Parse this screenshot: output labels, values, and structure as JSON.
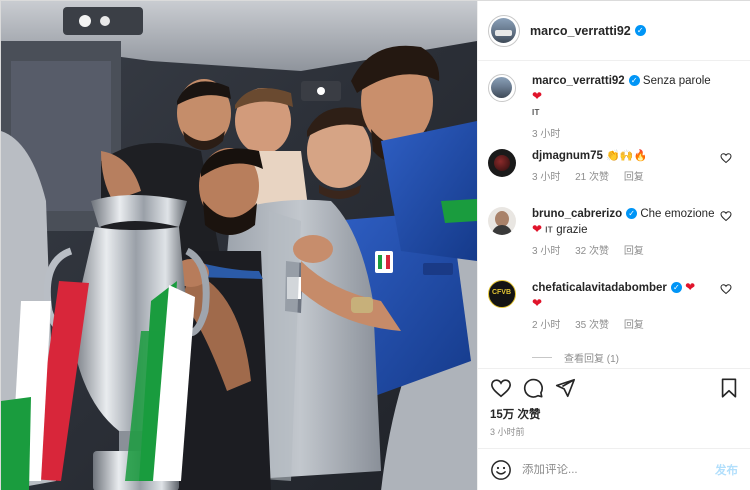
{
  "post": {
    "author": "marco_verratti92",
    "author_verified": true,
    "caption": {
      "text": "Senza parole",
      "heart": "❤",
      "flag": "IT",
      "time": "3 小时"
    },
    "photo_description_icon": "team-photo-with-trophy"
  },
  "comments": [
    {
      "user": "djmagnum75",
      "verified": false,
      "text": "",
      "emojis": [
        "👏",
        "🙌",
        "🔥"
      ],
      "time": "3 小时",
      "likes": "21 次赞",
      "reply": "回复"
    },
    {
      "user": "bruno_cabrerizo",
      "verified": true,
      "text": "Che emozione",
      "heart": "❤",
      "flag": "IT",
      "text_after": "grazie",
      "time": "3 小时",
      "likes": "32 次赞",
      "reply": "回复"
    },
    {
      "user": "chefaticalavitadabomber",
      "verified": true,
      "heart1": "❤",
      "heart2": "❤",
      "avatar_text": "CFVB",
      "time": "2 小时",
      "likes": "35 次赞",
      "reply": "回复",
      "view_replies": "查看回复 (1)"
    }
  ],
  "actions": {
    "likes": "15万 次赞",
    "time_ago": "3 小时前"
  },
  "add_comment": {
    "placeholder": "添加评论...",
    "post_label": "发布"
  },
  "colors": {
    "verified": "#0095f6",
    "heart_red": "#e0142b",
    "italy_blue": "#1b4aa8",
    "post_button_disabled": "#b2dffc"
  }
}
